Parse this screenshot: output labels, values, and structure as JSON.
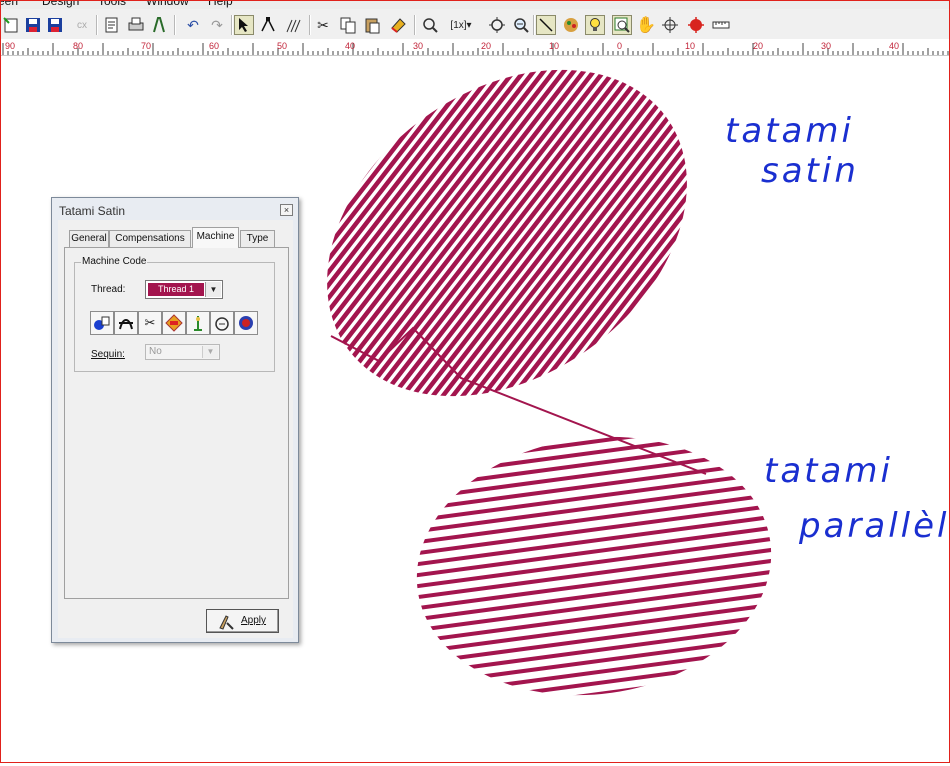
{
  "menu": [
    "een",
    "Design",
    "Tools",
    "Window",
    "Help"
  ],
  "toolbar_icons": [
    "new-icon",
    "save-icon",
    "save-as-icon",
    "cx-icon",
    "properties-icon",
    "print-icon",
    "stitch-player-icon",
    "undo-icon",
    "redo-icon",
    "select-icon",
    "reshape-icon",
    "stitch-edit-icon",
    "cut-icon",
    "copy-icon",
    "paste-icon",
    "eraser-icon",
    "zoom-box-icon",
    "zoom-1x-icon",
    "zoom-to-fit-icon",
    "zoom-out-icon",
    "draw-line-icon",
    "color-wheel-icon",
    "bulb-icon",
    "zoom-window-icon",
    "pan-hand-icon",
    "crosshair-icon",
    "stop-icon",
    "ruler-icon"
  ],
  "ruler_labels": [
    "90",
    "80",
    "70",
    "60",
    "50",
    "40",
    "30",
    "20",
    "10",
    "0",
    "10",
    "20",
    "30",
    "40"
  ],
  "canvas": {
    "annotation_1_line1": "tatami",
    "annotation_1_line2": "satin",
    "annotation_2_line1": "tatami",
    "annotation_2_line2": "parallèle",
    "stitch_color": "#a3154e",
    "annotation_color": "#1a2fd0"
  },
  "dialog": {
    "title": "Tatami Satin",
    "close_glyph": "×",
    "tabs": [
      "General",
      "Compensations",
      "Machine",
      "Type"
    ],
    "selected_tab": "Machine",
    "group_label": "Machine Code",
    "thread_label": "Thread:",
    "thread_value": "Thread 1",
    "thread_color": "#a3154e",
    "machine_icons": [
      "sequin-icon",
      "jump-icon",
      "trim-icon",
      "stop-sign-icon",
      "needle-icon",
      "tie-off-icon",
      "color-change-icon"
    ],
    "sequin_label": "Sequin:",
    "sequin_value": "No",
    "apply_label": "Apply"
  }
}
